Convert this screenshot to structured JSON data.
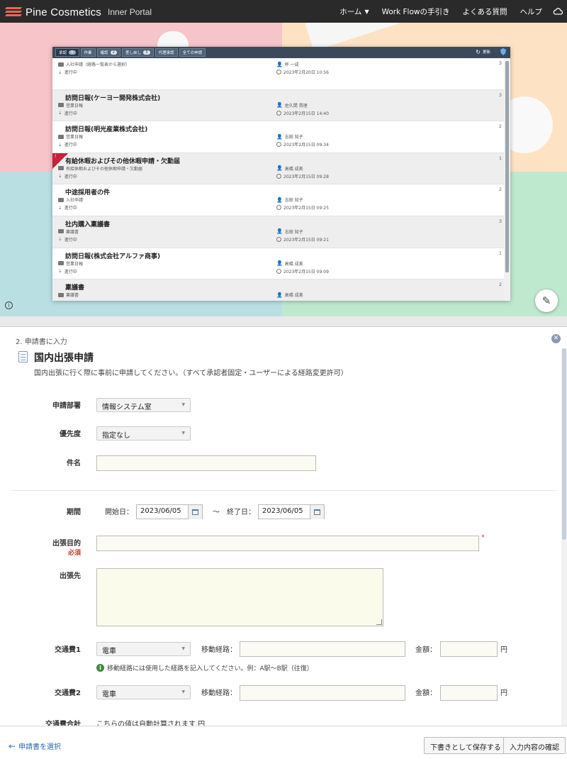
{
  "app": {
    "brand": "Pine Cosmetics",
    "subtitle": "Inner Portal"
  },
  "nav": {
    "home": "ホーム",
    "workflow_guide": "Work Flowの手引き",
    "faq": "よくある質問",
    "help": "ヘルプ"
  },
  "inbox": {
    "tabs": [
      {
        "label": "承認",
        "count": "9"
      },
      {
        "label": "作業"
      },
      {
        "label": "確認",
        "count": "2"
      },
      {
        "label": "差し戻し",
        "count": "3"
      },
      {
        "label": "代理承認"
      },
      {
        "label": "全ての申請"
      }
    ],
    "refresh_label": "更新",
    "rows": [
      {
        "title": "",
        "category": "入社申請（経路一覧表から選択）",
        "status": "進行中",
        "user": "杯 一成",
        "date": "2023年2月20日 10:56",
        "count": "3"
      },
      {
        "title": "訪問日報(ケーヨー開発株式会社)",
        "category": "営業日報",
        "status": "進行中",
        "user": "佐久間 貫理",
        "date": "2023年2月15日 14:40",
        "count": "3"
      },
      {
        "title": "訪問日報(明光産業株式会社)",
        "category": "営業日報",
        "status": "進行中",
        "user": "吉田 知子",
        "date": "2023年2月15日 09:34",
        "count": "2"
      },
      {
        "title": "有給休暇およびその他休暇申請・欠勤届",
        "category": "有給休暇およびその他休暇申請・欠勤届",
        "status": "進行中",
        "user": "高橋 成美",
        "date": "2023年2月15日 09:28",
        "count": "1",
        "ribbon": "!"
      },
      {
        "title": "中途採用者の件",
        "category": "入社申請",
        "status": "進行中",
        "user": "吉田 知子",
        "date": "2023年2月15日 09:25",
        "count": "2"
      },
      {
        "title": "社内購入稟議書",
        "category": "稟議書",
        "status": "進行中",
        "user": "吉田 知子",
        "date": "2023年2月15日 09:21",
        "count": "3"
      },
      {
        "title": "訪問日報(株式会社アルファ商事)",
        "category": "営業日報",
        "status": "進行中",
        "user": "高橋 成美",
        "date": "2023年2月15日 09:09",
        "count": "1"
      },
      {
        "title": "稟議書",
        "category": "稟議書",
        "status": "",
        "user": "高橋 成美",
        "date": "",
        "count": "2"
      }
    ]
  },
  "form": {
    "step": "2. 申請書に入力",
    "title": "国内出張申請",
    "description": "国内出張に行く際に事前に申請してください。（すべて承認者固定・ユーザーによる経路変更許可）",
    "department": {
      "label": "申請部署",
      "value": "情報システム室"
    },
    "priority": {
      "label": "優先度",
      "value": "指定なし"
    },
    "subject": {
      "label": "件名",
      "value": ""
    },
    "period": {
      "label": "期間",
      "start_label": "開始日：",
      "start_value": "2023/06/05",
      "tilde": "〜",
      "end_label": "終了日：",
      "end_value": "2023/06/05"
    },
    "purpose": {
      "label": "出張目的",
      "required": "必須",
      "star": "*",
      "value": ""
    },
    "destination": {
      "label": "出張先",
      "value": ""
    },
    "transport1": {
      "label": "交通費1",
      "mode": "電車",
      "route_label": "移動経路：",
      "route_value": "",
      "amount_label": "金額：",
      "amount_value": "",
      "unit": "円"
    },
    "transport_hint": "移動経路には使用した経路を記入してください。例：A駅〜B駅（往復）",
    "transport2": {
      "label": "交通費2",
      "mode": "電車",
      "route_label": "移動経路：",
      "route_value": "",
      "amount_label": "金額：",
      "amount_value": "",
      "unit": "円"
    },
    "transport_total": {
      "label": "交通費合計",
      "value": "こちらの値は自動計算されます 円"
    }
  },
  "footer": {
    "back": "申請書を選択",
    "save_draft": "下書きとして保存する",
    "confirm": "入力内容の確認"
  }
}
